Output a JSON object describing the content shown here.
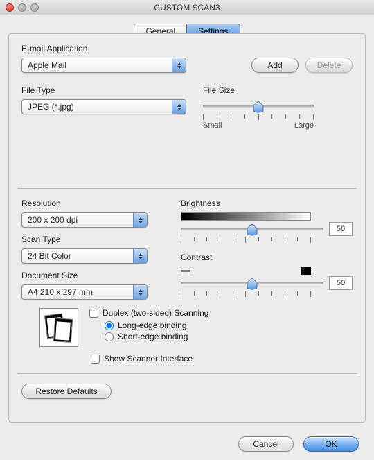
{
  "window": {
    "title": "CUSTOM SCAN3"
  },
  "tabs": {
    "general": "General",
    "settings": "Settings",
    "active": "settings"
  },
  "email": {
    "label": "E-mail Application",
    "value": "Apple Mail",
    "add_btn": "Add",
    "delete_btn": "Delete"
  },
  "filetype": {
    "label": "File Type",
    "value": "JPEG (*.jpg)"
  },
  "filesize": {
    "label": "File Size",
    "small": "Small",
    "large": "Large",
    "percent": 50
  },
  "resolution": {
    "label": "Resolution",
    "value": "200 x 200 dpi"
  },
  "scantype": {
    "label": "Scan Type",
    "value": "24 Bit Color"
  },
  "docsize": {
    "label": "Document Size",
    "value": "A4  210 x 297 mm"
  },
  "brightness": {
    "label": "Brightness",
    "value": "50",
    "percent": 50
  },
  "contrast": {
    "label": "Contrast",
    "value": "50",
    "percent": 50
  },
  "duplex": {
    "label": "Duplex (two-sided) Scanning",
    "long": "Long-edge binding",
    "short": "Short-edge binding",
    "checked": false,
    "selected": "long"
  },
  "showscanner": {
    "label": "Show Scanner Interface",
    "checked": false
  },
  "restore_btn": "Restore Defaults",
  "cancel_btn": "Cancel",
  "ok_btn": "OK"
}
